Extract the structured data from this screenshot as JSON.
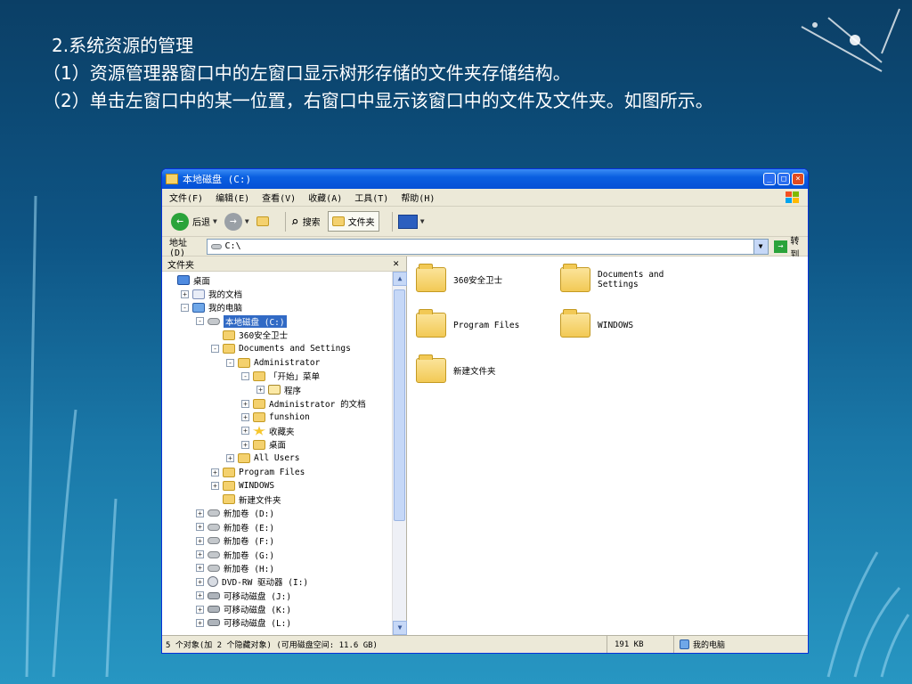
{
  "slide": {
    "line1": "2.系统资源的管理",
    "line2": "（1）资源管理器窗口中的左窗口显示树形存储的文件夹存储结构。",
    "line3": "（2）单击左窗口中的某一位置，右窗口中显示该窗口中的文件及文件夹。如图所示。"
  },
  "window": {
    "title": "本地磁盘 (C:)",
    "menu": [
      "文件(F)",
      "编辑(E)",
      "查看(V)",
      "收藏(A)",
      "工具(T)",
      "帮助(H)"
    ],
    "toolbar": {
      "back": "后退",
      "search": "搜索",
      "folders": "文件夹"
    },
    "address": {
      "label": "地址(D)",
      "value": "C:\\",
      "go": "转到"
    },
    "tree_header": "文件夹",
    "tree": [
      {
        "label": "桌面",
        "icon": "desktop-icon",
        "toggle": ""
      },
      {
        "label": "我的文档",
        "icon": "docs-icon",
        "toggle": "+"
      },
      {
        "label": "我的电脑",
        "icon": "computer-icon",
        "toggle": "-"
      },
      {
        "label": "本地磁盘 (C:)",
        "icon": "drive-icon",
        "toggle": "-",
        "selected": true
      },
      {
        "label": "360安全卫士",
        "icon": "folder-icon",
        "toggle": ""
      },
      {
        "label": "Documents and Settings",
        "icon": "folder-icon",
        "toggle": "-"
      },
      {
        "label": "Administrator",
        "icon": "folder-icon",
        "toggle": "-"
      },
      {
        "label": "「开始」菜单",
        "icon": "folder-icon",
        "toggle": "-"
      },
      {
        "label": "程序",
        "icon": "programs-icon",
        "toggle": "+"
      },
      {
        "label": "Administrator 的文档",
        "icon": "folder-icon",
        "toggle": "+"
      },
      {
        "label": "funshion",
        "icon": "folder-icon",
        "toggle": "+"
      },
      {
        "label": "收藏夹",
        "icon": "favorites-icon",
        "toggle": "+"
      },
      {
        "label": "桌面",
        "icon": "folder-icon",
        "toggle": "+"
      },
      {
        "label": "All Users",
        "icon": "folder-icon",
        "toggle": "+"
      },
      {
        "label": "Program Files",
        "icon": "folder-icon",
        "toggle": "+"
      },
      {
        "label": "WINDOWS",
        "icon": "folder-icon",
        "toggle": "+"
      },
      {
        "label": "新建文件夹",
        "icon": "folder-icon",
        "toggle": ""
      },
      {
        "label": "新加卷 (D:)",
        "icon": "drive-icon",
        "toggle": "+"
      },
      {
        "label": "新加卷 (E:)",
        "icon": "drive-icon",
        "toggle": "+"
      },
      {
        "label": "新加卷 (F:)",
        "icon": "drive-icon",
        "toggle": "+"
      },
      {
        "label": "新加卷 (G:)",
        "icon": "drive-icon",
        "toggle": "+"
      },
      {
        "label": "新加卷 (H:)",
        "icon": "drive-icon",
        "toggle": "+"
      },
      {
        "label": "DVD-RW 驱动器 (I:)",
        "icon": "dvd-icon",
        "toggle": "+"
      },
      {
        "label": "可移动磁盘 (J:)",
        "icon": "removable-icon",
        "toggle": "+"
      },
      {
        "label": "可移动磁盘 (K:)",
        "icon": "removable-icon",
        "toggle": "+"
      },
      {
        "label": "可移动磁盘 (L:)",
        "icon": "removable-icon",
        "toggle": "+"
      }
    ],
    "files": [
      {
        "name": "360安全卫士"
      },
      {
        "name": "Documents and Settings"
      },
      {
        "name": "Program Files"
      },
      {
        "name": "WINDOWS"
      },
      {
        "name": "新建文件夹"
      }
    ],
    "status": {
      "objects": "5 个对象(加 2 个隐藏对象) (可用磁盘空间: 11.6 GB)",
      "size": "191 KB",
      "location": "我的电脑"
    }
  }
}
